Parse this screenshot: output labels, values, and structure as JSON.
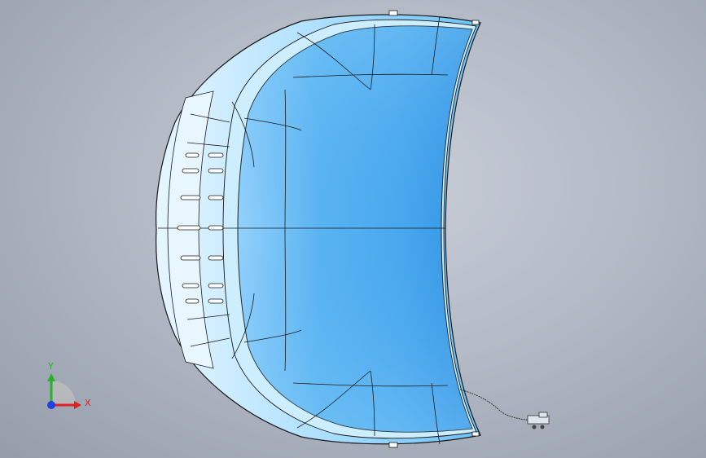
{
  "scene": {
    "description_model": "hood-panel-part",
    "colors": {
      "background_center": "#c9ced8",
      "background_edge": "#959dab",
      "part_light": "#bfe8ff",
      "part_mid": "#6cc0f5",
      "part_dark": "#2e8ee0",
      "edge_line": "#1a1a1a"
    }
  },
  "triad": {
    "x_label": "X",
    "y_label": "Y",
    "x_color": "#e02020",
    "y_color": "#2ab02a",
    "z_color": "#2040e0"
  }
}
